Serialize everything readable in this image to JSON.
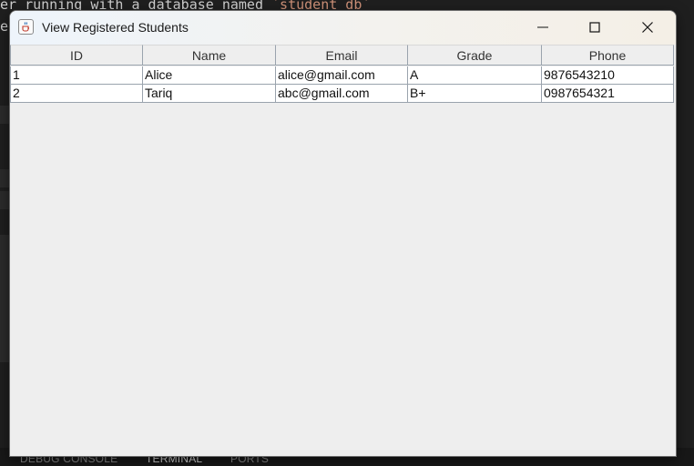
{
  "background": {
    "editor_line1_prefix": "er running with a database named ",
    "editor_line1_string": "`student_db`",
    "editor_line2": "ed",
    "terminal_tabs": [
      "DEBUG CONSOLE",
      "TERMINAL",
      "PORTS"
    ]
  },
  "window": {
    "title": "View Registered Students",
    "icon": "java-cup-icon",
    "controls": [
      "minimize-icon",
      "maximize-icon",
      "close-icon"
    ]
  },
  "table": {
    "columns": [
      "ID",
      "Name",
      "Email",
      "Grade",
      "Phone"
    ],
    "rows": [
      [
        "1",
        "Alice",
        "alice@gmail.com",
        "A",
        "9876543210"
      ],
      [
        "2",
        "Tariq",
        "abc@gmail.com",
        "B+",
        "0987654321"
      ]
    ]
  },
  "colors": {
    "accent_title_gradient_start": "#eef4fb",
    "accent_title_gradient_end": "#f4efe6",
    "grid": "#9aa3ad",
    "window_bg": "#eeeeee"
  }
}
